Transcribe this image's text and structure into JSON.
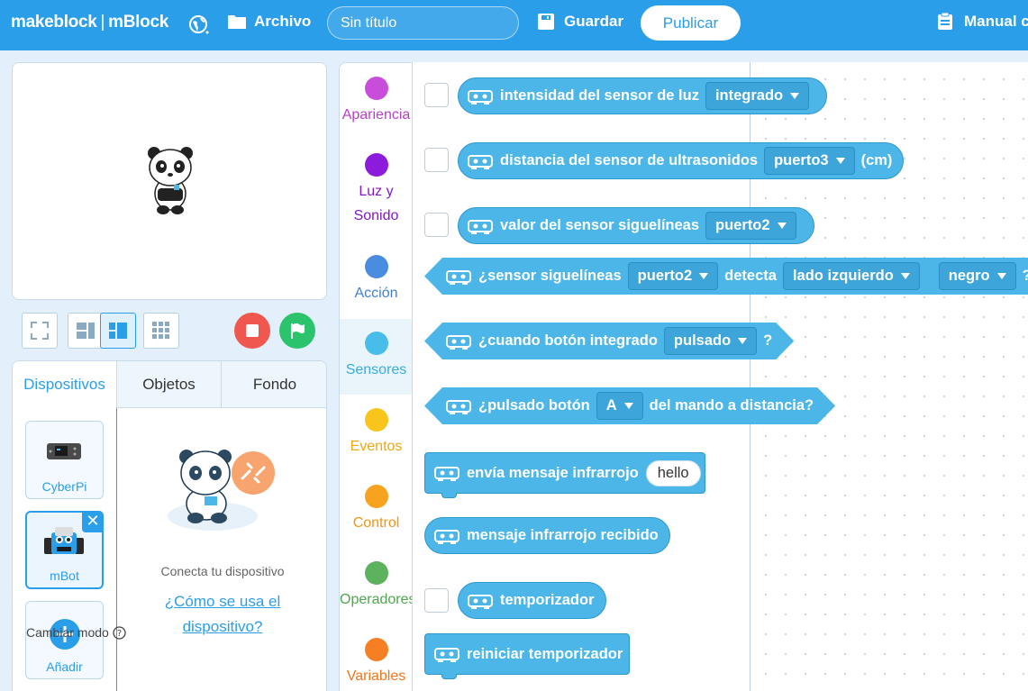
{
  "topbar": {
    "brand": "makeblock",
    "brand_sep": "|",
    "product": "mBlock",
    "file_menu": "Archivo",
    "project_title": "Sin título",
    "save_label": "Guardar",
    "publish_label": "Publicar",
    "manual_label": "Manual c"
  },
  "stage_tabs": [
    {
      "label": "Dispositivos"
    },
    {
      "label": "Objetos"
    },
    {
      "label": "Fondo"
    }
  ],
  "devices": [
    {
      "label": "CyberPi"
    },
    {
      "label": "mBot"
    },
    {
      "label": "Añadir"
    }
  ],
  "connect": {
    "message": "Conecta tu dispositivo",
    "howto_line1": "¿Cómo se usa el",
    "howto_line2": "dispositivo?",
    "mode_label": "Cambiar modo"
  },
  "categories": [
    {
      "label": "Apariencia",
      "color": "#c94ddb",
      "text_color": "#b641c6"
    },
    {
      "label": "Luz y Sonido",
      "color": "#8d1bdb",
      "text_color": "#8019c8"
    },
    {
      "label": "Acción",
      "color": "#4a8ce0",
      "text_color": "#3f80d3"
    },
    {
      "label": "Sensores",
      "color": "#49bde9",
      "text_color": "#36aee0"
    },
    {
      "label": "Eventos",
      "color": "#f7c51b",
      "text_color": "#e8a911"
    },
    {
      "label": "Control",
      "color": "#f7a320",
      "text_color": "#ef9614"
    },
    {
      "label": "Operadores",
      "color": "#5db35d",
      "text_color": "#4fa64f"
    },
    {
      "label": "Variables",
      "color": "#f77f23",
      "text_color": "#f0751b"
    }
  ],
  "blocks": {
    "light": {
      "text": "intensidad del sensor de luz",
      "dropdown": "integrado"
    },
    "ultrasonic": {
      "text": "distancia del sensor de ultrasonidos",
      "dropdown": "puerto3",
      "suffix": "(cm)"
    },
    "linefollower": {
      "text": "valor del sensor siguelíneas",
      "dropdown": "puerto2"
    },
    "linedetect": {
      "text1": "¿sensor siguelíneas",
      "dropdown1": "puerto2",
      "text2": "detecta",
      "dropdown2": "lado izquierdo",
      "dropdown3": "negro",
      "suffix": "?"
    },
    "button": {
      "text": "¿cuando botón integrado",
      "dropdown": "pulsado",
      "suffix": "?"
    },
    "remote": {
      "text1": "¿pulsado botón",
      "dropdown": "A",
      "text2": "del mando a distancia?"
    },
    "ir_send": {
      "text": "envía mensaje infrarrojo",
      "input": "hello"
    },
    "ir_received": {
      "text": "mensaje infrarrojo recibido"
    },
    "timer": {
      "text": "temporizador"
    },
    "timer_reset": {
      "text": "reiniciar temporizador"
    }
  },
  "colors": {
    "accent": "#2b9ee9",
    "sensor_block": "#4cb6e8",
    "stop": "#f0584f",
    "go": "#2bc46c"
  }
}
